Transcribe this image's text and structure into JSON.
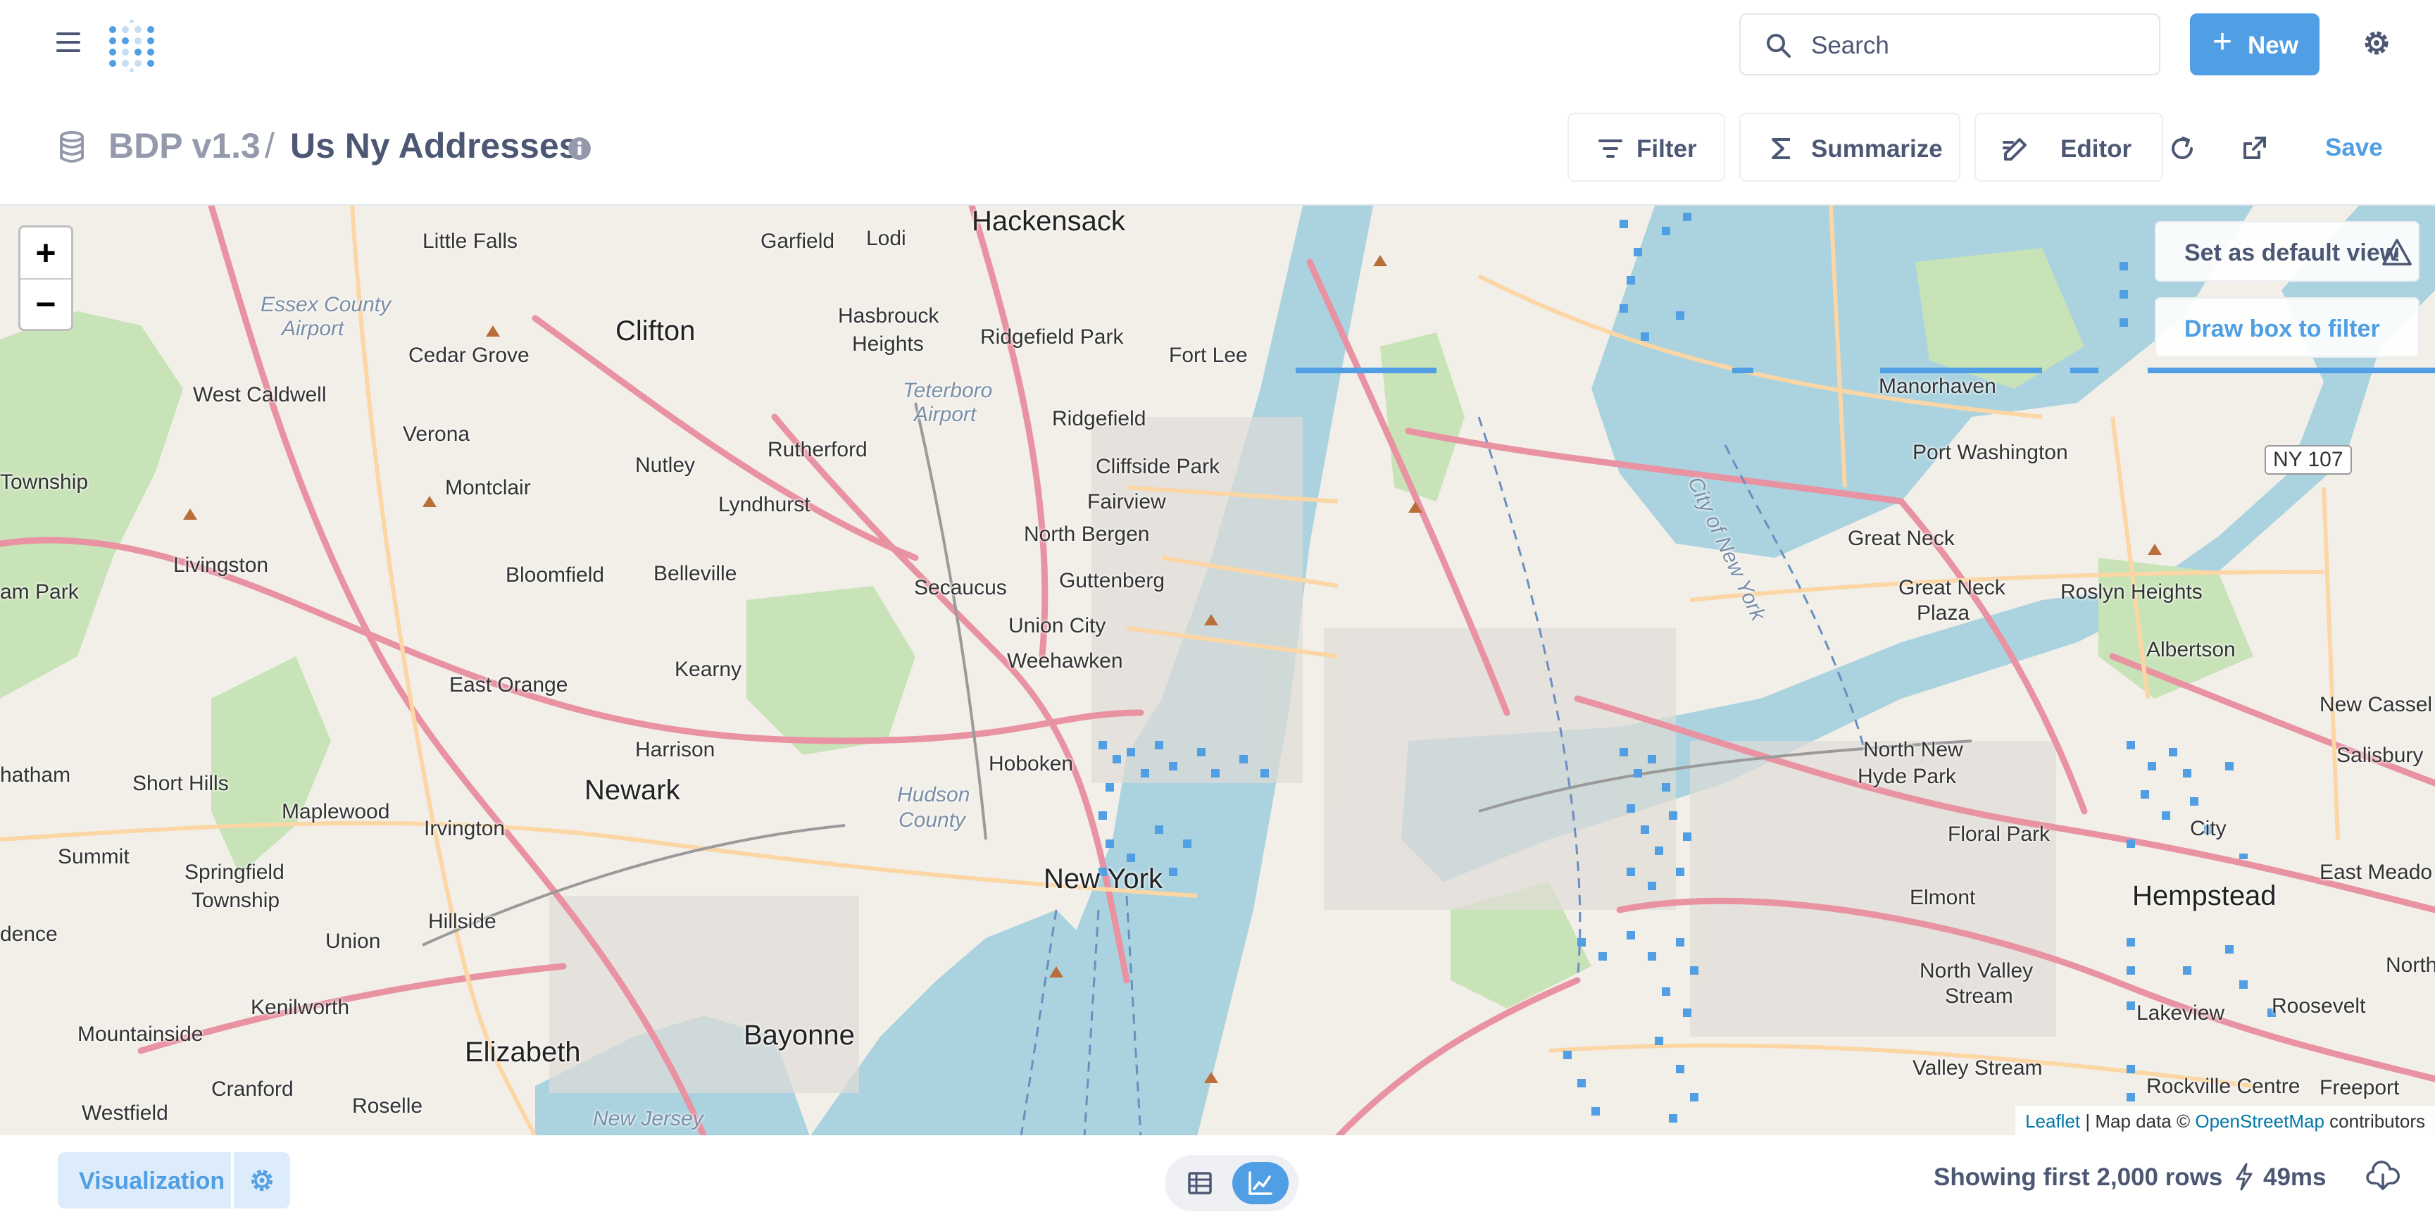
{
  "nav": {
    "search_placeholder": "Search",
    "new_label": "New",
    "new_icon": "plus-icon",
    "accent_color": "#509ee3"
  },
  "header": {
    "database": "BDP v1.3",
    "separator": "/",
    "title": "Us Ny Addresses",
    "filter_label": "Filter",
    "summarize_label": "Summarize",
    "editor_label": "Editor",
    "save_label": "Save"
  },
  "map": {
    "zoom_in": "+",
    "zoom_out": "−",
    "set_default_view": "Set as default view",
    "draw_box_filter": "Draw box to filter",
    "attribution": {
      "leaflet": "Leaflet",
      "sep": " | Map data © ",
      "osm": "OpenStreetMap",
      "contributors": " contributors"
    },
    "places": {
      "hackensack": "Hackensack",
      "little_falls": "Little Falls",
      "garfield": "Garfield",
      "lodi": "Lodi",
      "clifton": "Clifton",
      "hasbrouck": "Hasbrouck",
      "heights": "Heights",
      "ridgefield_park": "Ridgefield Park",
      "fort_lee": "Fort Lee",
      "essex": "Essex County",
      "airport": "Airport",
      "cedar_grove": "Cedar Grove",
      "west_caldwell": "West Caldwell",
      "teterboro": "Teterboro",
      "teterboro_airport": "Airport",
      "ridgefield": "Ridgefield",
      "verona": "Verona",
      "nutley": "Nutley",
      "rutherford": "Rutherford",
      "cliffside_park": "Cliffside Park",
      "fairview": "Fairview",
      "township": "Township",
      "montclair": "Montclair",
      "lyndhurst": "Lyndhurst",
      "north_bergen": "North Bergen",
      "livingston": "Livingston",
      "bloomfield": "Bloomfield",
      "belleville": "Belleville",
      "secaucus": "Secaucus",
      "guttenberg": "Guttenberg",
      "union_city": "Union City",
      "weehawken": "Weehawken",
      "kearny": "Kearny",
      "east_orange": "East Orange",
      "harrison": "Harrison",
      "hoboken": "Hoboken",
      "hudson": "Hudson",
      "county": "County",
      "newark": "Newark",
      "short_hills": "Short Hills",
      "maplewood": "Maplewood",
      "irvington": "Irvington",
      "summit": "Summit",
      "springfield": "Springfield",
      "springfield_twp": "Township",
      "hillside": "Hillside",
      "union": "Union",
      "new_york": "New York",
      "kenilworth": "Kenilworth",
      "mountainside": "Mountainside",
      "elizabeth": "Elizabeth",
      "bayonne": "Bayonne",
      "cranford": "Cranford",
      "roselle": "Roselle",
      "westfield": "Westfield",
      "new_jersey": "New Jersey",
      "am_park": "am Park",
      "dence": "dence",
      "hatham": "hatham",
      "manorhaven": "Manorhaven",
      "port_washington": "Port Washington",
      "ny107": "NY 107",
      "great_neck": "Great Neck",
      "great_neck_plaza": "Great Neck",
      "plaza": "Plaza",
      "roslyn_heights": "Roslyn Heights",
      "albertson": "Albertson",
      "new_cassel": "New Cassel",
      "salisbury": "Salisbury",
      "north_new": "North New",
      "hyde_park": "Hyde Park",
      "floral_park": "Floral Park",
      "garden_city": "City",
      "east_meadow": "East Meado",
      "hempstead": "Hempstead",
      "elmont": "Elmont",
      "north_valley": "North Valley",
      "stream": "Stream",
      "lakeview": "Lakeview",
      "roosevelt": "Roosevelt",
      "valley_stream": "Valley Stream",
      "rockville_centre": "Rockville Centre",
      "freeport": "Freeport",
      "north": "North",
      "city_of_new_york": "City of New York"
    }
  },
  "footer": {
    "visualization_label": "Visualization",
    "row_count": "Showing first 2,000 rows",
    "timing": "49ms"
  }
}
